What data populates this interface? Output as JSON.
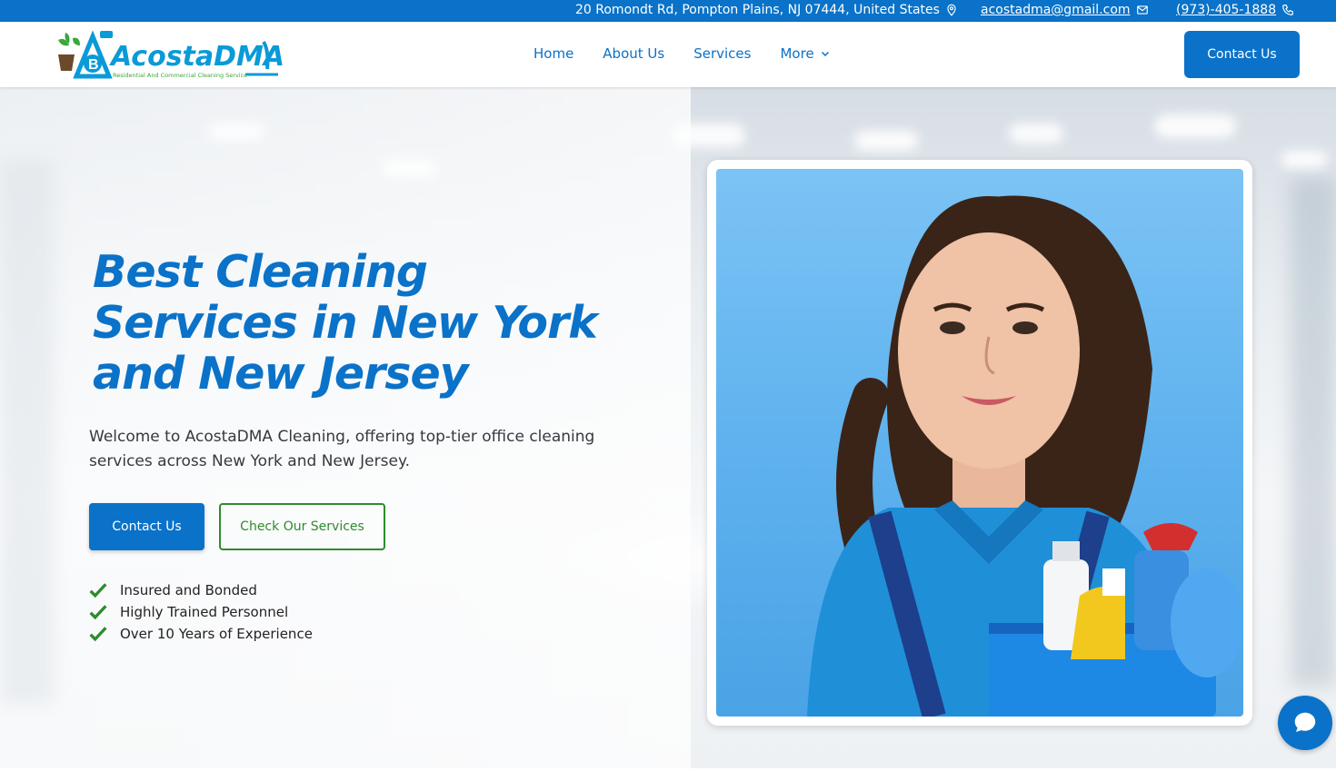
{
  "topbar": {
    "address": "20 Romondt Rd, Pompton Plains, NJ 07444, United States",
    "email": "acostadma@gmail.com",
    "phone": "(973)-405-1888"
  },
  "logo": {
    "name": "AcostaDMA",
    "tagline": "Residential And Commercial Cleaning Service"
  },
  "nav": {
    "items": [
      {
        "label": "Home"
      },
      {
        "label": "About Us"
      },
      {
        "label": "Services"
      },
      {
        "label": "More"
      }
    ],
    "cta_label": "Contact Us"
  },
  "hero": {
    "headline_lines": [
      "Best Cleaning",
      "Services in New York",
      "and New Jersey"
    ],
    "intro": "Welcome to AcostaDMA Cleaning, offering top-tier office cleaning services across New York and New Jersey.",
    "primary_button": "Contact Us",
    "secondary_button": "Check Our Services",
    "features": [
      "Insured and Bonded",
      "Highly Trained Personnel",
      "Over 10 Years of Experience"
    ]
  },
  "colors": {
    "brand_blue": "#0a72c8",
    "accent_green": "#2d8c2d"
  },
  "icons": {
    "address": "map-pin-icon",
    "email": "mail-icon",
    "phone": "phone-icon",
    "more": "chevron-down-icon",
    "feature": "check-icon",
    "chat": "chat-icon"
  }
}
